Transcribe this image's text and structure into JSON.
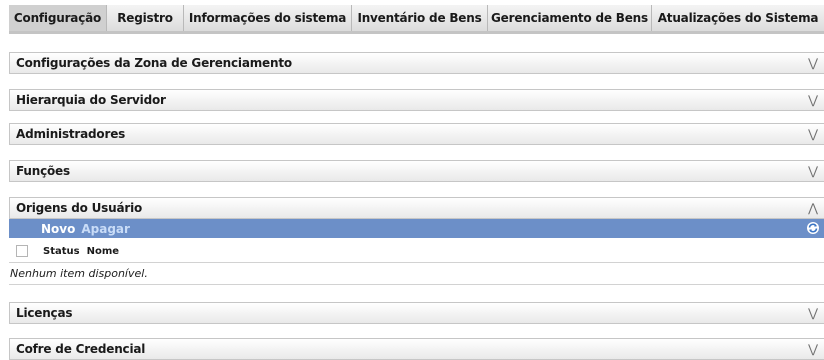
{
  "tabs": [
    {
      "label": "Configuração",
      "active": true
    },
    {
      "label": "Registro",
      "active": false
    },
    {
      "label": "Informações do sistema",
      "active": false
    },
    {
      "label": "Inventário de Bens",
      "active": false
    },
    {
      "label": "Gerenciamento de Bens",
      "active": false
    },
    {
      "label": "Atualizações do Sistema",
      "active": false
    }
  ],
  "panels": [
    {
      "title": "Configurações da Zona de Gerenciamento",
      "expanded": false,
      "icon": "chevron-double-down-icon"
    },
    {
      "title": "Hierarquia do Servidor",
      "expanded": false,
      "icon": "chevron-double-down-icon"
    },
    {
      "title": "Administradores",
      "expanded": false,
      "icon": "chevron-double-down-icon"
    },
    {
      "title": "Funções",
      "expanded": false,
      "icon": "chevron-double-down-icon"
    },
    {
      "title": "Origens do Usuário",
      "expanded": true,
      "icon": "chevron-double-up-icon"
    },
    {
      "title": "Licenças",
      "expanded": false,
      "icon": "chevron-double-down-icon"
    },
    {
      "title": "Cofre de Credencial",
      "expanded": false,
      "icon": "chevron-double-down-icon"
    }
  ],
  "user_sources": {
    "toolbar": {
      "new_label": "Novo",
      "delete_label": "Apagar",
      "refresh_icon": "refresh-icon"
    },
    "columns": [
      "Status",
      "Nome"
    ],
    "empty_message": "Nenhum item disponível."
  },
  "colors": {
    "toolbar_bg": "#6c8fc8",
    "tab_active_bg": "#d0d0d0",
    "panel_border": "#c6c6c6"
  }
}
